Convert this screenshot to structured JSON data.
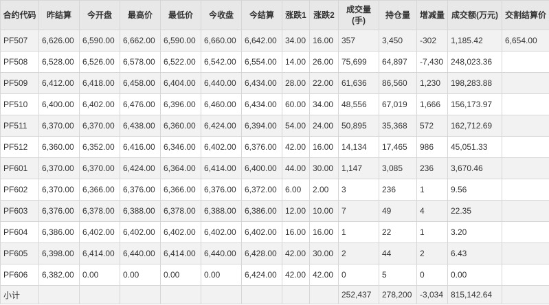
{
  "table": {
    "headers": [
      "合约代码",
      "昨结算",
      "今开盘",
      "最高价",
      "最低价",
      "今收盘",
      "今结算",
      "涨跌1",
      "涨跌2",
      "成交量(手)",
      "持仓量",
      "增减量",
      "成交额(万元)",
      "交割结算价"
    ],
    "rows": [
      [
        "PF507",
        "6,626.00",
        "6,590.00",
        "6,662.00",
        "6,590.00",
        "6,660.00",
        "6,642.00",
        "34.00",
        "16.00",
        "357",
        "3,450",
        "-302",
        "1,185.42",
        "6,654.00"
      ],
      [
        "PF508",
        "6,528.00",
        "6,526.00",
        "6,578.00",
        "6,522.00",
        "6,542.00",
        "6,554.00",
        "14.00",
        "26.00",
        "75,699",
        "64,897",
        "-7,430",
        "248,023.36",
        ""
      ],
      [
        "PF509",
        "6,412.00",
        "6,418.00",
        "6,458.00",
        "6,404.00",
        "6,440.00",
        "6,434.00",
        "28.00",
        "22.00",
        "61,636",
        "86,560",
        "1,230",
        "198,283.88",
        ""
      ],
      [
        "PF510",
        "6,400.00",
        "6,402.00",
        "6,476.00",
        "6,396.00",
        "6,460.00",
        "6,434.00",
        "60.00",
        "34.00",
        "48,556",
        "67,019",
        "1,666",
        "156,173.97",
        ""
      ],
      [
        "PF511",
        "6,370.00",
        "6,370.00",
        "6,438.00",
        "6,360.00",
        "6,424.00",
        "6,394.00",
        "54.00",
        "24.00",
        "50,895",
        "35,368",
        "572",
        "162,712.69",
        ""
      ],
      [
        "PF512",
        "6,360.00",
        "6,352.00",
        "6,416.00",
        "6,346.00",
        "6,402.00",
        "6,376.00",
        "42.00",
        "16.00",
        "14,134",
        "17,465",
        "986",
        "45,051.33",
        ""
      ],
      [
        "PF601",
        "6,370.00",
        "6,370.00",
        "6,424.00",
        "6,364.00",
        "6,414.00",
        "6,400.00",
        "44.00",
        "30.00",
        "1,147",
        "3,085",
        "236",
        "3,670.46",
        ""
      ],
      [
        "PF602",
        "6,370.00",
        "6,366.00",
        "6,376.00",
        "6,366.00",
        "6,376.00",
        "6,372.00",
        "6.00",
        "2.00",
        "3",
        "236",
        "1",
        "9.56",
        ""
      ],
      [
        "PF603",
        "6,376.00",
        "6,378.00",
        "6,388.00",
        "6,378.00",
        "6,388.00",
        "6,386.00",
        "12.00",
        "10.00",
        "7",
        "49",
        "4",
        "22.35",
        ""
      ],
      [
        "PF604",
        "6,386.00",
        "6,402.00",
        "6,402.00",
        "6,402.00",
        "6,402.00",
        "6,402.00",
        "16.00",
        "16.00",
        "1",
        "22",
        "1",
        "3.20",
        ""
      ],
      [
        "PF605",
        "6,398.00",
        "6,414.00",
        "6,440.00",
        "6,414.00",
        "6,440.00",
        "6,428.00",
        "42.00",
        "30.00",
        "2",
        "44",
        "2",
        "6.43",
        ""
      ],
      [
        "PF606",
        "6,382.00",
        "0.00",
        "0.00",
        "0.00",
        "0.00",
        "6,424.00",
        "42.00",
        "42.00",
        "0",
        "5",
        "0",
        "0.00",
        ""
      ]
    ],
    "subtotal": [
      "小计",
      "",
      "",
      "",
      "",
      "",
      "",
      "",
      "",
      "252,437",
      "278,200",
      "-3,034",
      "815,142.64",
      ""
    ]
  }
}
